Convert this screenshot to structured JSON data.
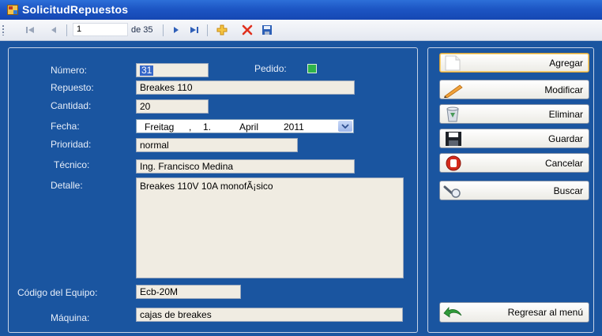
{
  "window": {
    "title": "SolicitudRepuestos"
  },
  "toolbar": {
    "position_value": "1",
    "count_label": "de 35",
    "icons": [
      "move-first-icon",
      "move-previous-icon",
      "move-next-icon",
      "move-last-icon",
      "add-new-icon",
      "delete-icon",
      "save-icon"
    ]
  },
  "form": {
    "numero": {
      "label": "Número:",
      "value": "31"
    },
    "pedido": {
      "label": "Pedido:",
      "checked": true
    },
    "repuesto": {
      "label": "Repuesto:",
      "value": "Breakes 110"
    },
    "cantidad": {
      "label": "Cantidad:",
      "value": "20"
    },
    "fecha": {
      "label": "Fecha:",
      "weekday": "Freitag",
      "day": "1.",
      "month": "April",
      "year": "2011",
      "sep": ","
    },
    "prioridad": {
      "label": "Prioridad:",
      "value": "normal"
    },
    "tecnico": {
      "label": "Técnico:",
      "value": "Ing. Francisco Medina"
    },
    "detalle": {
      "label": "Detalle:",
      "value": "Breakes 110V 10A monofÃ¡sico"
    },
    "codigo": {
      "label": "Código del Equipo:",
      "value": "Ecb-20M"
    },
    "maquina": {
      "label": "Máquina:",
      "value": "cajas de breakes"
    }
  },
  "actions": {
    "agregar": "Agregar",
    "modificar": "Modificar",
    "eliminar": "Eliminar",
    "guardar": "Guardar",
    "cancelar": "Cancelar",
    "buscar": "Buscar",
    "regresar": "Regresar al menú"
  },
  "colors": {
    "form_background": "#1a55a0",
    "title_bar": "#1d56c4",
    "field_background": "#f0ece2",
    "checkbox_green": "#2eb34a",
    "selection": "#3667c9"
  }
}
